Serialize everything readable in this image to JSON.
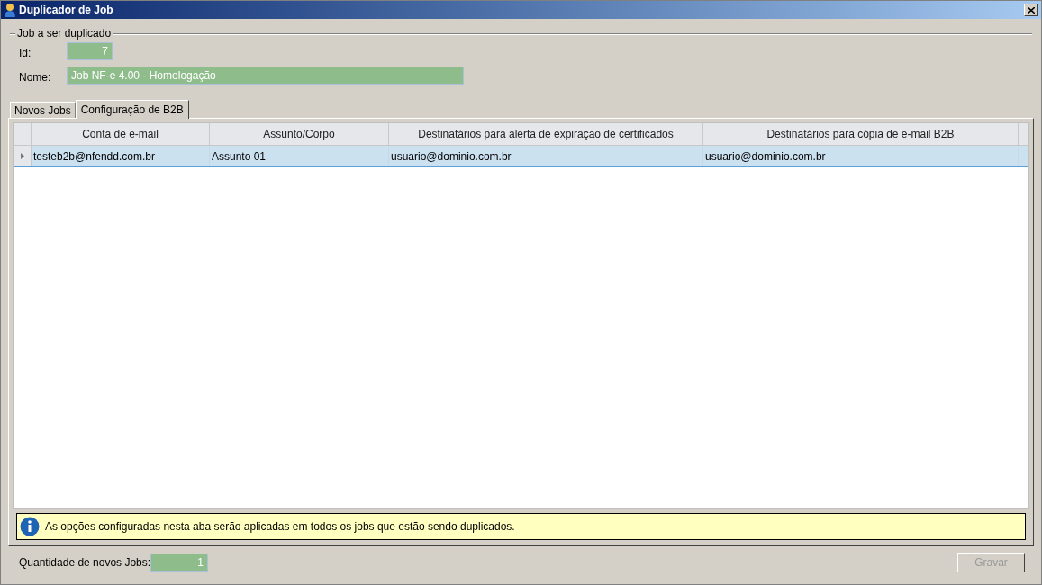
{
  "window": {
    "title": "Duplicador de Job"
  },
  "group": {
    "title": "Job a ser duplicado",
    "fields": [
      {
        "label": "Id:",
        "value": "7"
      },
      {
        "label": "Nome:",
        "value": "Job NF-e 4.00 - Homologação"
      }
    ]
  },
  "tabs": [
    {
      "label": "Novos Jobs",
      "selected": false
    },
    {
      "label": "Configuração de B2B",
      "selected": true
    }
  ],
  "table": {
    "columns": [
      "Conta de e-mail",
      "Assunto/Corpo",
      "Destinatários para alerta de expiração de certificados",
      "Destinatários para cópia de e-mail B2B"
    ],
    "rows": [
      {
        "selected": true,
        "cells": [
          "testeb2b@nfendd.com.br",
          "Assunto 01",
          "usuario@dominio.com.br",
          "usuario@dominio.com.br"
        ]
      }
    ]
  },
  "info": {
    "text": "As opções configuradas nesta aba serão aplicadas em todos os jobs que estão sendo duplicados."
  },
  "quantity": {
    "label": "Quantidade de novos Jobs:",
    "value": "1"
  },
  "save_button": {
    "label": "Gravar",
    "disabled": true
  }
}
